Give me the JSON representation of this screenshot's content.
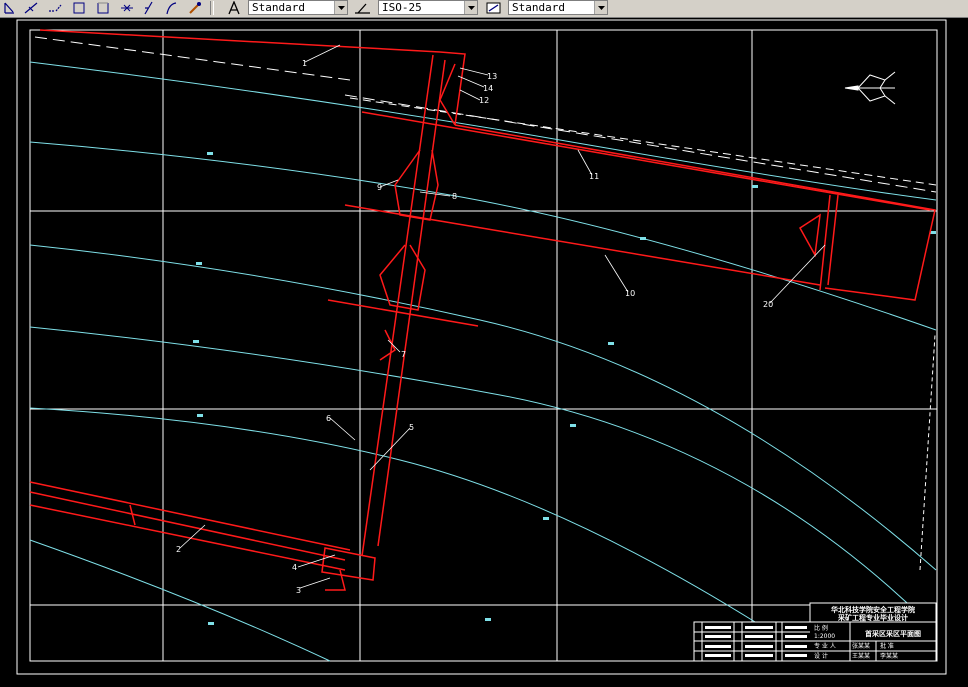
{
  "toolbar": {
    "text_style": "Standard",
    "dim_style": "ISO-25",
    "table_style": "Standard",
    "icons": [
      "dim-linear-icon",
      "dim-aligned-icon",
      "dim-ordinate-icon",
      "dim-radius-icon",
      "dim-diameter-icon",
      "dim-angular-icon",
      "dim-quick-icon",
      "dim-baseline-icon",
      "dim-continue-icon",
      "dim-leader-icon",
      "dim-tolerance-icon",
      "dim-center-icon",
      "text-style-icon",
      "dim-style-icon",
      "table-style-icon"
    ]
  },
  "drawing": {
    "callouts": [
      {
        "id": "1",
        "text": "1"
      },
      {
        "id": "2",
        "text": "2"
      },
      {
        "id": "3",
        "text": "3"
      },
      {
        "id": "4",
        "text": "4"
      },
      {
        "id": "5",
        "text": "5"
      },
      {
        "id": "6",
        "text": "6"
      },
      {
        "id": "7",
        "text": "7"
      },
      {
        "id": "8",
        "text": "8"
      },
      {
        "id": "9",
        "text": "9"
      },
      {
        "id": "10",
        "text": "10"
      },
      {
        "id": "11",
        "text": "11"
      },
      {
        "id": "12",
        "text": "12"
      },
      {
        "id": "13",
        "text": "13"
      },
      {
        "id": "14",
        "text": "14"
      },
      {
        "id": "20",
        "text": "20"
      }
    ],
    "colors": {
      "background": "#000000",
      "grid": "#ffffff",
      "contour": "#7fe0e8",
      "roadway": "#ff1a1a",
      "annotation": "#ffffff"
    }
  },
  "title_block": {
    "school_line1": "华北科技学院安全工程学院",
    "school_line2": "采矿工程专业毕业设计",
    "scale_label": "比 例",
    "scale_value": "1:2000",
    "major_label": "专 业 人",
    "drawing_title": "首采区采区平面图",
    "row_labels": [
      "设 计",
      "审 核",
      "批 准"
    ],
    "row_values": [
      "张某某",
      "王某某",
      "李某某"
    ]
  }
}
